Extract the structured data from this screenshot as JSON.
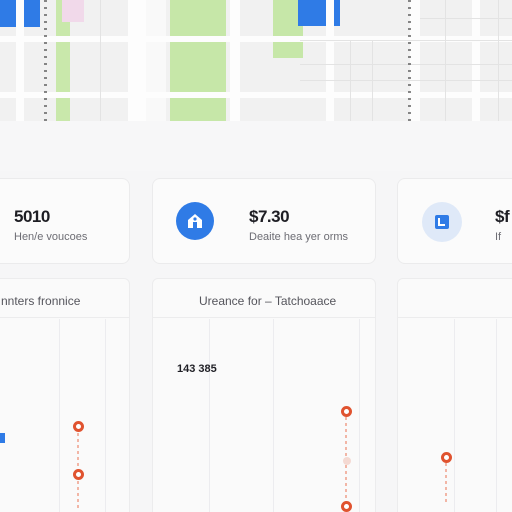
{
  "stats": [
    {
      "value": "5010",
      "label": "Hen/e voucoes",
      "icon": ""
    },
    {
      "value": "$7.30",
      "label": "Deaite hea yer orms",
      "icon": "home-icon"
    },
    {
      "value": "$f",
      "label": "If",
      "icon": "calendar-icon"
    }
  ],
  "panels": [
    {
      "title": "nnters fronnice"
    },
    {
      "title": "Ureance for – Tatchoaace"
    }
  ],
  "annotation": "143 385",
  "colors": {
    "accent": "#2f7be6",
    "marker": "#e0532f",
    "map_park": "#c6e7a8"
  }
}
